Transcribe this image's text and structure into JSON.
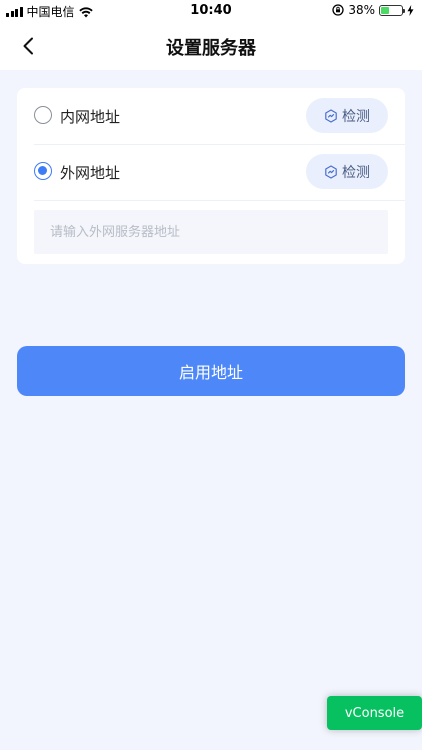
{
  "status_bar": {
    "carrier": "中国电信",
    "time": "10:40",
    "battery": "38%",
    "battery_level": 0.38
  },
  "nav": {
    "title": "设置服务器",
    "back_icon": "chevron-left-icon"
  },
  "options": [
    {
      "label": "内网地址",
      "checked": false,
      "detect_label": "检测"
    },
    {
      "label": "外网地址",
      "checked": true,
      "detect_label": "检测"
    }
  ],
  "address_input": {
    "value": "",
    "placeholder": "请输入外网服务器地址"
  },
  "primary_button": {
    "label": "启用地址"
  },
  "vconsole": {
    "label": "vConsole"
  },
  "colors": {
    "accent": "#4e88f8",
    "radio_checked": "#3e7bf6",
    "vconsole": "#07c160",
    "background": "#f2f5fd"
  }
}
